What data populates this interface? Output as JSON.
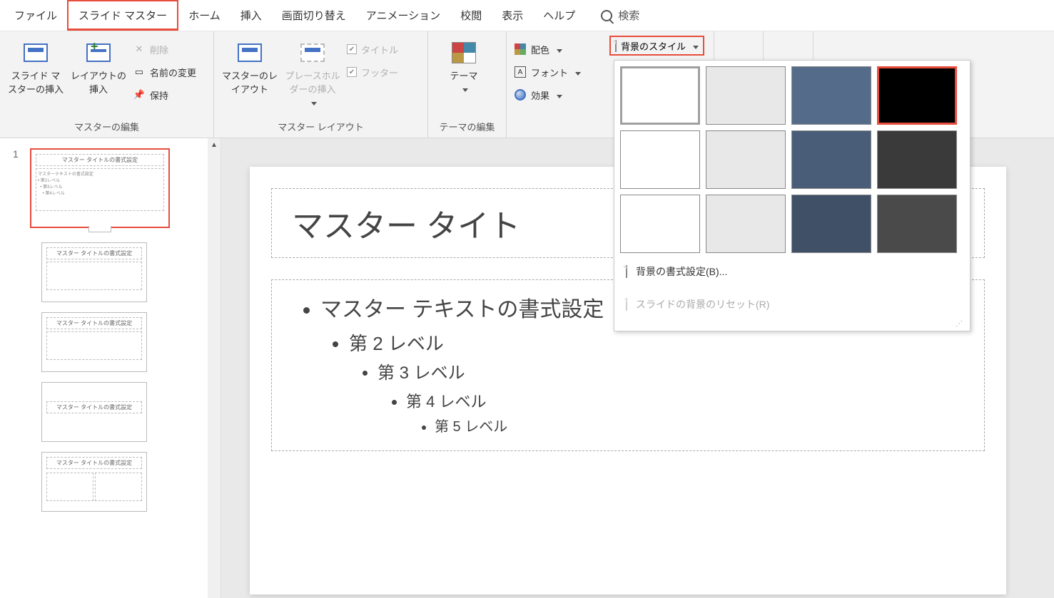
{
  "tabs": {
    "file": "ファイル",
    "slide_master": "スライド マスター",
    "home": "ホーム",
    "insert": "挿入",
    "transition": "画面切り替え",
    "animation": "アニメーション",
    "review": "校閲",
    "view": "表示",
    "help": "ヘルプ",
    "search": "検索"
  },
  "ribbon": {
    "group1_label": "マスターの編集",
    "insert_slide_master": "スライド マスターの挿入",
    "insert_layout": "レイアウトの挿入",
    "delete": "削除",
    "rename": "名前の変更",
    "preserve": "保持",
    "group2_label": "マスター レイアウト",
    "master_layout": "マスターのレイアウト",
    "insert_placeholder": "プレースホルダーの挿入",
    "chk_title": "タイトル",
    "chk_footer": "フッター",
    "group3_label": "テーマの編集",
    "theme": "テーマ",
    "colors": "配色",
    "fonts": "フォント",
    "effects": "効果",
    "bg_styles": "背景のスタイル"
  },
  "dropdown": {
    "format_bg": "背景の書式設定(B)...",
    "reset_bg": "スライドの背景のリセット(R)",
    "swatches": [
      {
        "color": "#ffffff",
        "sel": "gray"
      },
      {
        "color": "#e8e8e8",
        "sel": ""
      },
      {
        "color": "#556b8a",
        "sel": ""
      },
      {
        "color": "#000000",
        "sel": "red"
      },
      {
        "color": "#ffffff",
        "sel": ""
      },
      {
        "color": "#e8e8e8",
        "sel": ""
      },
      {
        "color": "#4a5d78",
        "sel": ""
      },
      {
        "color": "#3a3a3a",
        "sel": ""
      },
      {
        "color": "#ffffff",
        "sel": ""
      },
      {
        "color": "#e8e8e8",
        "sel": ""
      },
      {
        "color": "#3f5067",
        "sel": ""
      },
      {
        "color": "#4a4a4a",
        "sel": ""
      }
    ]
  },
  "thumbs": {
    "num1": "1",
    "master_title": "マスター タイトルの書式設定",
    "master_body": "マスターテキストの書式設定",
    "sub_title": "マスター タイトルの書式設定"
  },
  "slide": {
    "title": "マスター タイト",
    "bullet1": "マスター テキストの書式設定",
    "bullet2": "第 2 レベル",
    "bullet3": "第 3 レベル",
    "bullet4": "第 4 レベル",
    "bullet5": "第 5 レベル"
  }
}
